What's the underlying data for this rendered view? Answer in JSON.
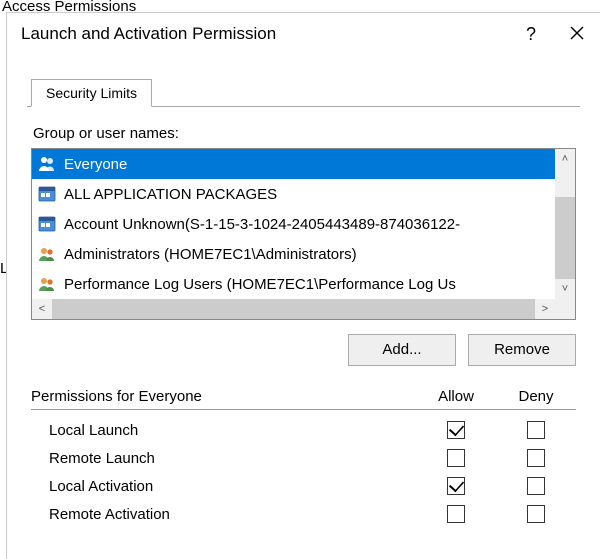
{
  "backdrop": {
    "title": "Access Permissions",
    "leftChar": "L"
  },
  "dialog": {
    "title": "Launch and Activation Permission",
    "helpGlyph": "?",
    "tab": "Security Limits",
    "groupLabel": "Group or user names:",
    "entries": [
      {
        "label": "Everyone",
        "icon": "group",
        "selected": true
      },
      {
        "label": "ALL APPLICATION PACKAGES",
        "icon": "package",
        "selected": false
      },
      {
        "label": "Account Unknown(S-1-15-3-1024-2405443489-874036122-",
        "icon": "package",
        "selected": false
      },
      {
        "label": "Administrators (HOME7EC1\\Administrators)",
        "icon": "users",
        "selected": false
      },
      {
        "label": "Performance Log Users (HOME7EC1\\Performance Log Us",
        "icon": "users",
        "selected": false
      }
    ],
    "scroll": {
      "up": "˄",
      "down": "˅",
      "left": "<",
      "right": ">"
    },
    "buttons": {
      "add": "Add...",
      "remove": "Remove"
    },
    "permHeader": {
      "label": "Permissions for Everyone",
      "allow": "Allow",
      "deny": "Deny"
    },
    "permissions": [
      {
        "name": "Local Launch",
        "allow": true,
        "deny": false
      },
      {
        "name": "Remote Launch",
        "allow": false,
        "deny": false
      },
      {
        "name": "Local Activation",
        "allow": true,
        "deny": false
      },
      {
        "name": "Remote Activation",
        "allow": false,
        "deny": false
      }
    ]
  }
}
